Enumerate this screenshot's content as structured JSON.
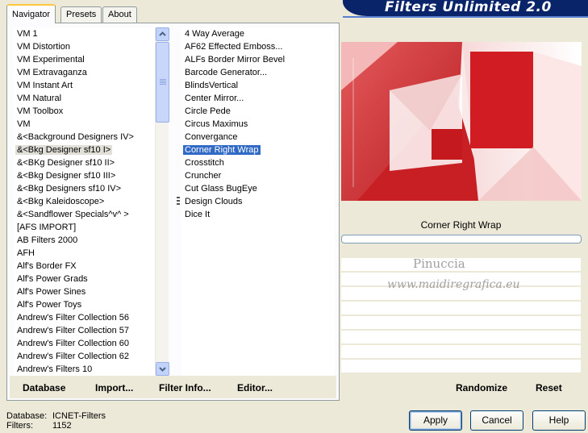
{
  "tabs": [
    {
      "label": "Navigator"
    },
    {
      "label": "Presets"
    },
    {
      "label": "About"
    }
  ],
  "banner": {
    "title": "Filters Unlimited 2.0"
  },
  "categories": [
    "VM 1",
    "VM Distortion",
    "VM Experimental",
    "VM Extravaganza",
    "VM Instant Art",
    "VM Natural",
    "VM Toolbox",
    "VM",
    "&<Background Designers IV>",
    "&<Bkg Designer sf10 I>",
    "&<BKg Designer sf10 II>",
    "&<Bkg Designer sf10 III>",
    "&<Bkg Designers sf10 IV>",
    "&<Bkg Kaleidoscope>",
    "&<Sandflower Specials^v^ >",
    "[AFS IMPORT]",
    "AB Filters 2000",
    "AFH",
    "Alf's Border FX",
    "Alf's Power Grads",
    "Alf's Power Sines",
    "Alf's Power Toys",
    "Andrew's Filter Collection 56",
    "Andrew's Filter Collection 57",
    "Andrew's Filter Collection 60",
    "Andrew's Filter Collection 62",
    "Andrew's Filters 10"
  ],
  "selected_category": "&<Bkg Designer sf10 I>",
  "filters": [
    "4 Way Average",
    "AF62 Effected Emboss...",
    "ALFs Border Mirror Bevel",
    "Barcode Generator...",
    "BlindsVertical",
    "Center Mirror...",
    "Circle Pede",
    "Circus Maximus",
    "Convergance",
    "Corner Right Wrap",
    "Crosstitch",
    "Cruncher",
    "Cut Glass  BugEye",
    "Design Clouds",
    "Dice It"
  ],
  "selected_filter": "Corner Right Wrap",
  "links": {
    "database": "Database",
    "import": "Import...",
    "filter_info": "Filter Info...",
    "editor": "Editor..."
  },
  "preview": {
    "filter_name": "Corner Right Wrap",
    "progress": 0,
    "watermark_line1": "Pinuccia",
    "watermark_line2": "www.maidiregrafica.eu"
  },
  "right_buttons": {
    "randomize": "Randomize",
    "reset": "Reset"
  },
  "status": {
    "database_label": "Database:",
    "database_value": "ICNET-Filters",
    "filters_label": "Filters:",
    "filters_value": "1152"
  },
  "dialog_buttons": {
    "apply": "Apply",
    "cancel": "Cancel",
    "help": "Help"
  },
  "colors": {
    "accent_blue": "#0a246a",
    "selection": "#316ac5",
    "preview_red": "#d42a2e"
  }
}
